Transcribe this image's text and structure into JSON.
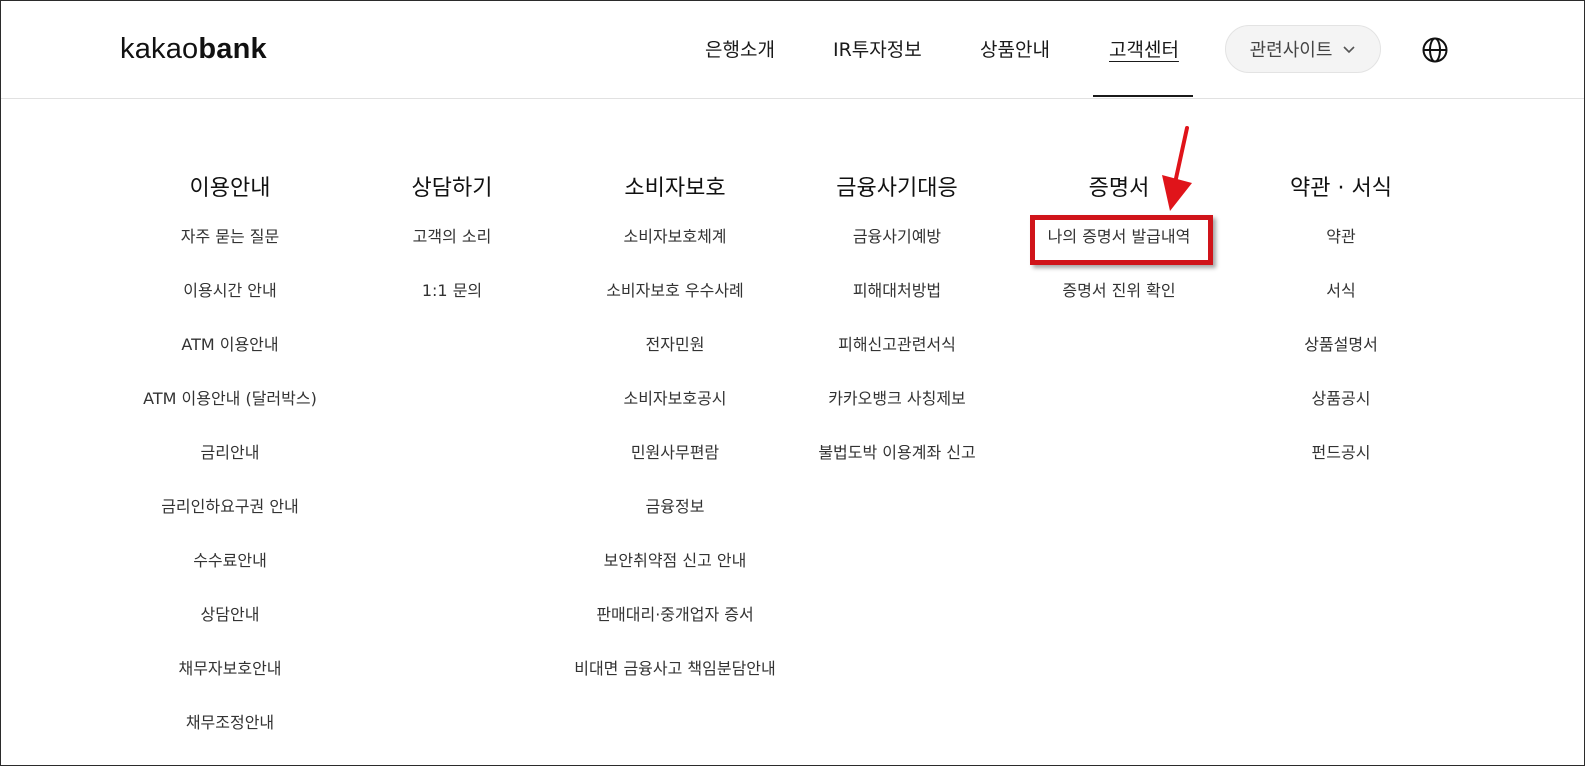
{
  "brand": {
    "logo_light": "kakao",
    "logo_bold": "bank"
  },
  "nav": {
    "items": [
      {
        "label": "은행소개"
      },
      {
        "label": "IR투자정보"
      },
      {
        "label": "상품안내"
      },
      {
        "label": "고객센터",
        "active": true
      }
    ],
    "related_sites": "관련사이트",
    "globe_icon": "globe-icon"
  },
  "menu": {
    "columns": [
      {
        "title": "이용안내",
        "links": [
          "자주 묻는 질문",
          "이용시간 안내",
          "ATM 이용안내",
          "ATM 이용안내 (달러박스)",
          "금리안내",
          "금리인하요구권 안내",
          "수수료안내",
          "상담안내",
          "채무자보호안내",
          "채무조정안내"
        ]
      },
      {
        "title": "상담하기",
        "links": [
          "고객의 소리",
          "1:1 문의"
        ]
      },
      {
        "title": "소비자보호",
        "links": [
          "소비자보호체계",
          "소비자보호 우수사례",
          "전자민원",
          "소비자보호공시",
          "민원사무편람",
          "금융정보",
          "보안취약점 신고 안내",
          "판매대리·중개업자 증서",
          "비대면 금융사고 책임분담안내"
        ]
      },
      {
        "title": "금융사기대응",
        "links": [
          "금융사기예방",
          "피해대처방법",
          "피해신고관련서식",
          "카카오뱅크 사칭제보",
          "불법도박 이용계좌 신고"
        ]
      },
      {
        "title": "증명서",
        "links": [
          "나의 증명서 발급내역",
          "증명서 진위 확인"
        ]
      },
      {
        "title": "약관 · 서식",
        "links": [
          "약관",
          "서식",
          "상품설명서",
          "상품공시",
          "펀드공시"
        ]
      }
    ]
  },
  "annotation": {
    "box_color": "#d0141a",
    "arrow_color": "#e0141a"
  }
}
